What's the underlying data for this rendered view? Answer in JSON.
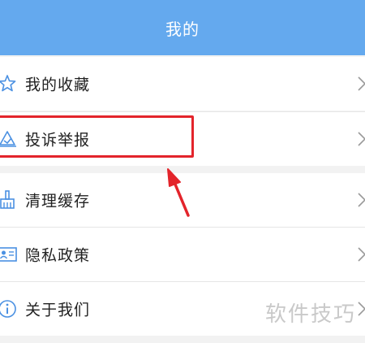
{
  "header": {
    "title": "我的"
  },
  "menu": [
    {
      "label": "我的收藏",
      "icon": "star-icon"
    },
    {
      "label": "投诉举报",
      "icon": "complaint-icon"
    },
    {
      "label": "清理缓存",
      "icon": "broom-icon"
    },
    {
      "label": "隐私政策",
      "icon": "id-card-icon"
    },
    {
      "label": "关于我们",
      "icon": "info-icon"
    }
  ],
  "annotation": {
    "highlight_color": "#e3242b"
  },
  "watermark": {
    "text": "软件技巧"
  },
  "colors": {
    "header_bg": "#64a9ee",
    "icon": "#4a90e2"
  }
}
